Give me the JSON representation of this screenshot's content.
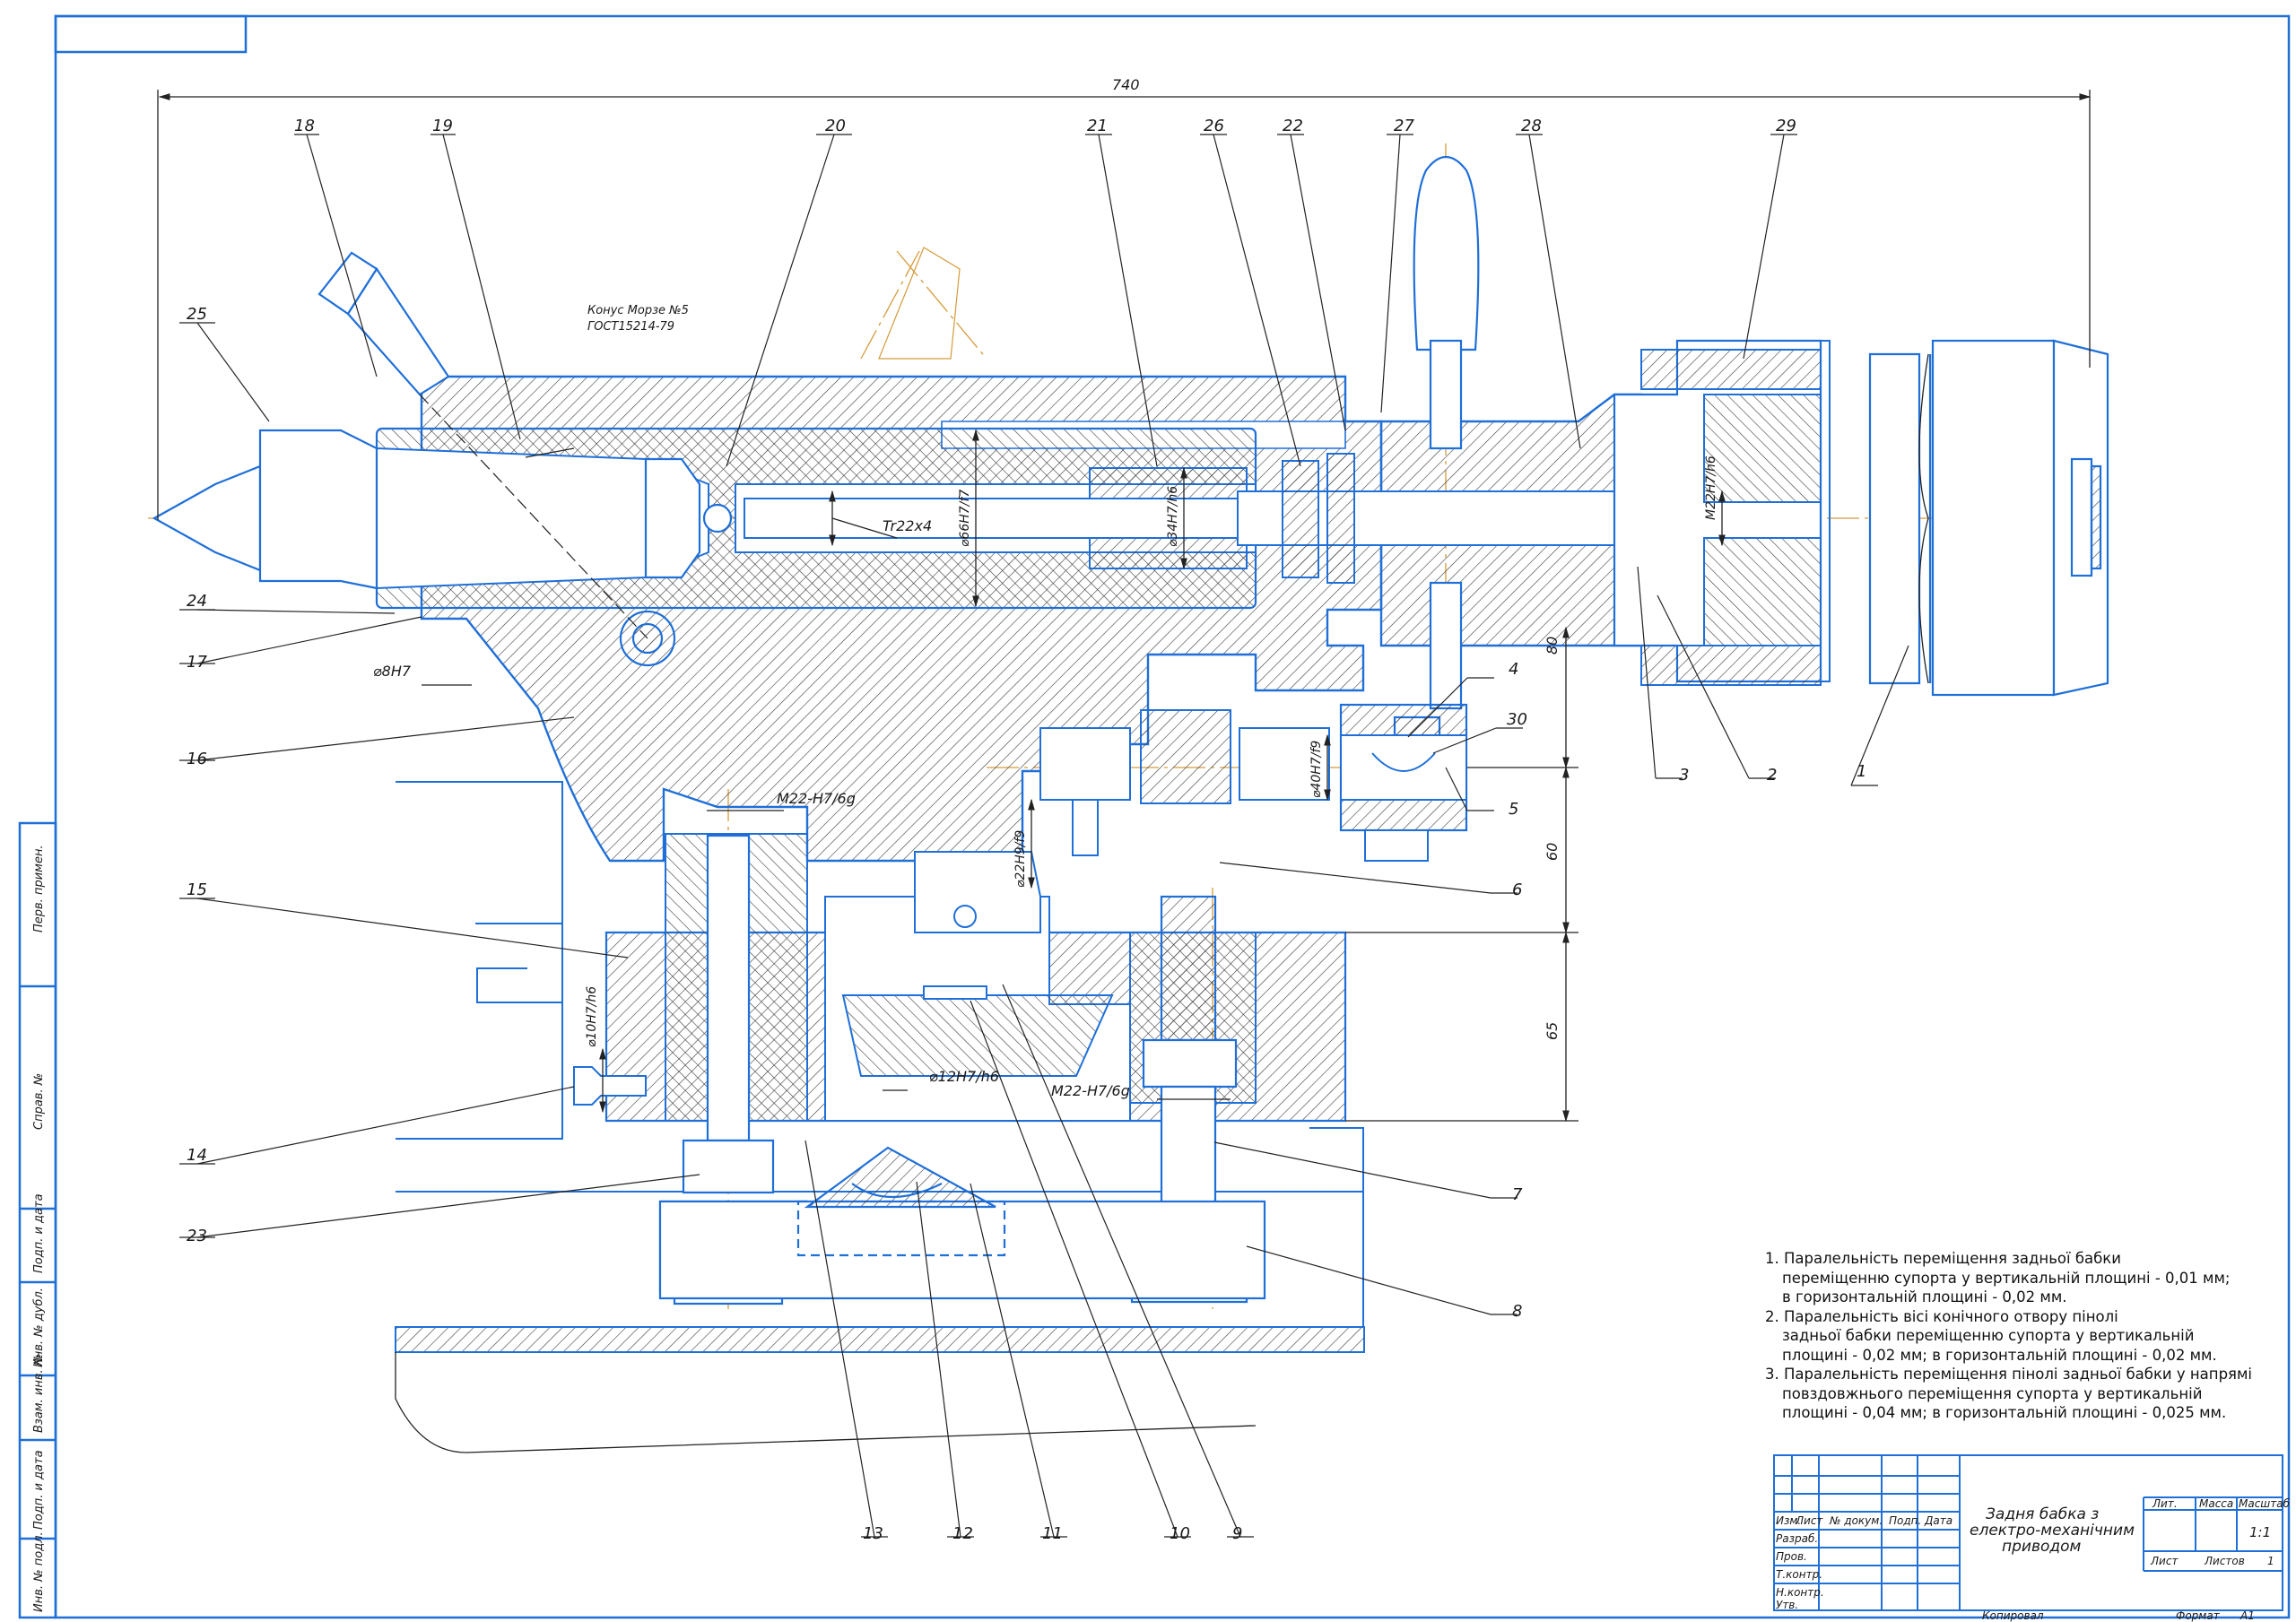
{
  "colors": {
    "outline": "#1f6fd8",
    "hatch": "#3b3b3b",
    "axis": "#d59a3a",
    "text": "#1a1a1a"
  },
  "dimensions": {
    "overall_length": "740",
    "morse_cone": "Конус Морзе №5",
    "gost": "ГОСТ15214-79",
    "thread_tr": "Tr22x4",
    "d66": "⌀66H7/f7",
    "d34": "⌀34H7/h6",
    "m22_ring": "M22H7/h6",
    "d8": "⌀8H7",
    "d40": "⌀40H7/f9",
    "d22": "⌀22H9/f9",
    "d10": "⌀10H7/h6",
    "d12": "⌀12H7/h6",
    "m22_left": "M22-H7/6g",
    "m22_right": "M22-H7/6g",
    "dim80": "80",
    "dim60": "60",
    "dim65": "65"
  },
  "callouts": {
    "c1": "1",
    "c2": "2",
    "c3": "3",
    "c4": "4",
    "c5": "5",
    "c6": "6",
    "c7": "7",
    "c8": "8",
    "c9": "9",
    "c10": "10",
    "c11": "11",
    "c12": "12",
    "c13": "13",
    "c14": "14",
    "c15": "15",
    "c16": "16",
    "c17": "17",
    "c18": "18",
    "c19": "19",
    "c20": "20",
    "c21": "21",
    "c22": "22",
    "c23": "23",
    "c24": "24",
    "c25": "25",
    "c26": "26",
    "c27": "27",
    "c28": "28",
    "c29": "29",
    "c30": "30"
  },
  "margin_labels": {
    "perv_primen": "Перв. примен.",
    "sprav": "Справ. №",
    "podp_data_top": "Подп. и дата",
    "inv_dubl": "Инв. № дубл.",
    "vzam_inv": "Взам. инв. №",
    "podp_data": "Подп. и дата",
    "inv_podl": "Инв. № подл."
  },
  "notes": {
    "n1": [
      "1. Паралельність переміщення задньої бабки",
      "переміщенню супорта у вертикальній площині - 0,01 мм;",
      "в горизонтальній площині - 0,02 мм."
    ],
    "n2": [
      "2. Паралельність вісі конічного отвору пінолі",
      "задньої бабки переміщенню супорта у вертикальній",
      "площині - 0,02 мм; в горизонтальній площині - 0,02 мм."
    ],
    "n3": [
      "3. Паралельність переміщення пінолі задньої бабки у напрямі",
      "повздовжнього переміщення супорта у вертикальній",
      "площині - 0,04 мм; в горизонтальній площині - 0,025 мм."
    ]
  },
  "title_block": {
    "title_lines": [
      "Задня бабка з",
      "електро-механічним",
      "приводом"
    ],
    "col_izm": "Изм.",
    "col_list": "Лист",
    "col_docum": "№ докум.",
    "col_podp": "Подп.",
    "col_data": "Дата",
    "row_razrab": "Разраб.",
    "row_prov": "Пров.",
    "row_tkontr": "Т.контр.",
    "row_nkontr": "Н.контр.",
    "row_utv": "Утв.",
    "lit": "Лит.",
    "massa": "Масса",
    "masshtab": "Масштаб",
    "scale_value": "1:1",
    "list": "Лист",
    "listov": "Листов",
    "listov_value": "1",
    "kopiroval": "Копировал",
    "format": "Формат",
    "format_value": "A1"
  }
}
